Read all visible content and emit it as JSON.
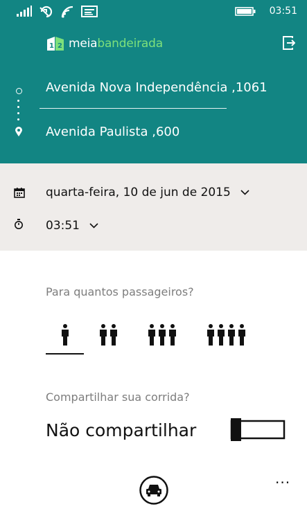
{
  "status_bar": {
    "time": "03:51",
    "icons": [
      "signal-icon",
      "data-sync-icon",
      "wifi-icon",
      "message-icon",
      "battery-icon"
    ]
  },
  "header": {
    "logo_part1": "meia",
    "logo_part2": "bandeirada",
    "exit_icon": "exit-icon"
  },
  "route": {
    "origin": "Avenida Nova Independência ,1061",
    "destination": "Avenida Paulista ,600"
  },
  "schedule": {
    "date": "quarta-feira, 10 de jun de 2015",
    "time": "03:51"
  },
  "passengers": {
    "question": "Para  quantos passageiros?",
    "options": [
      1,
      2,
      3,
      4
    ],
    "selected": 1
  },
  "share": {
    "question": "Compartilhar sua corrida?",
    "label": "Não compartilhar",
    "enabled": false
  },
  "colors": {
    "header_bg": "#128583",
    "band_bg": "#efecea",
    "logo_accent": "#7de07b"
  },
  "bottom_bar": {
    "primary_icon": "car-icon",
    "more_label": "..."
  }
}
